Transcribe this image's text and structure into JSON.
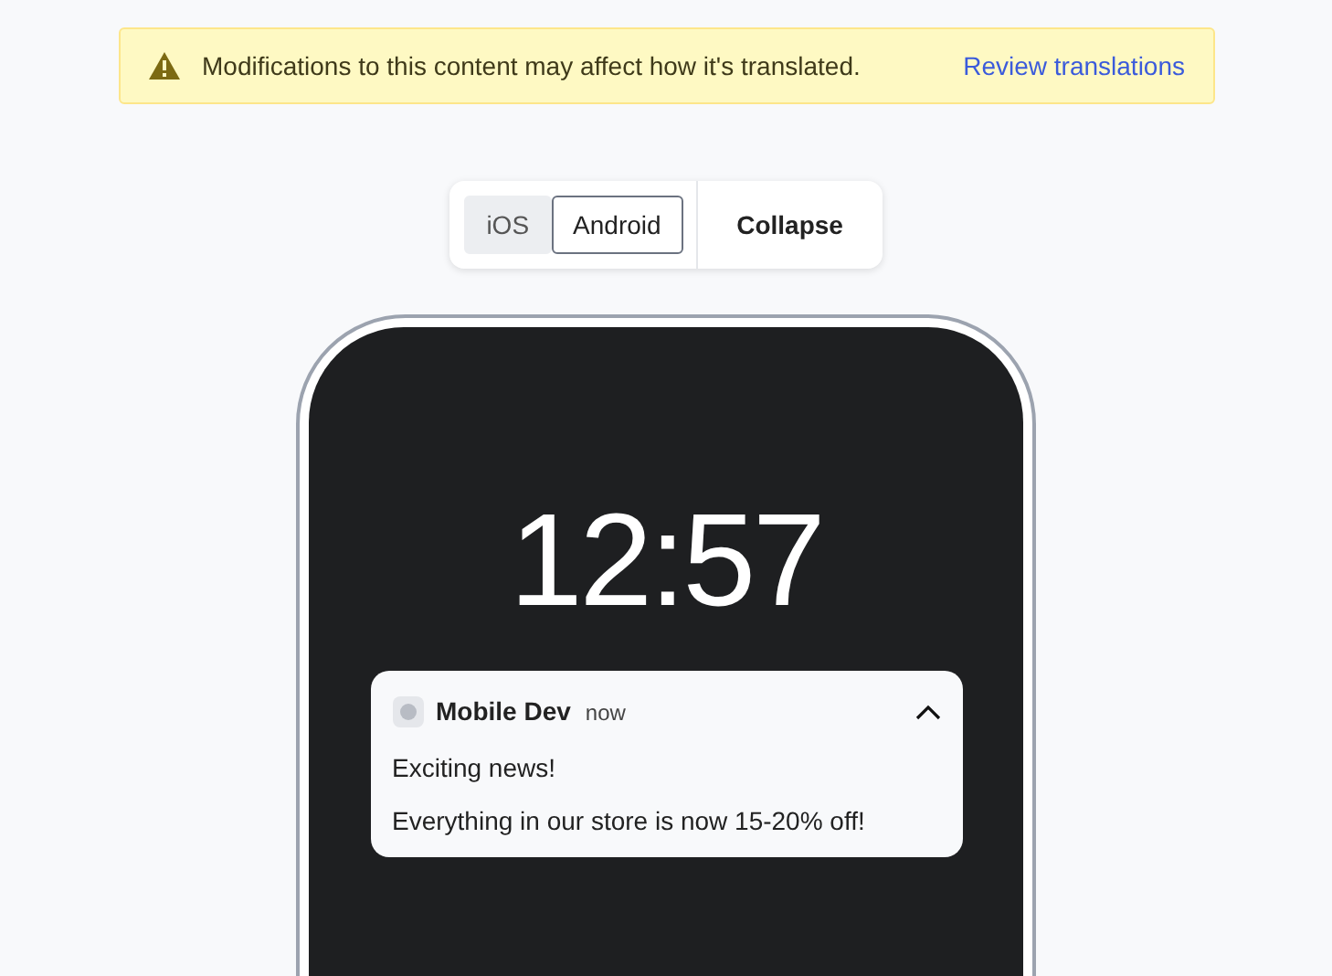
{
  "banner": {
    "message": "Modifications to this content may affect how it's translated.",
    "link": "Review translations"
  },
  "platform_tabs": [
    {
      "label": "iOS",
      "selected": false
    },
    {
      "label": "Android",
      "selected": true
    }
  ],
  "collapse_button": "Collapse",
  "phone": {
    "time": "12:57",
    "notification": {
      "app": "Mobile Dev",
      "time": "now",
      "expanded": true,
      "title": "Exciting news!",
      "body": "Everything in our store is now 15-20% off!"
    }
  }
}
